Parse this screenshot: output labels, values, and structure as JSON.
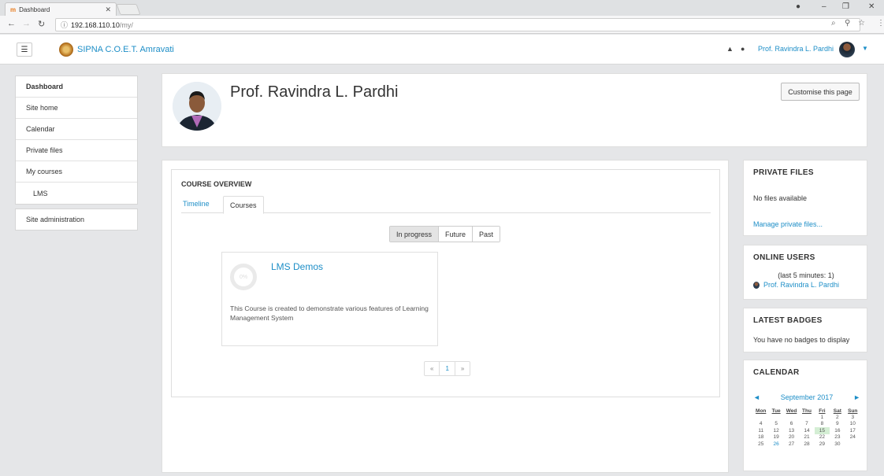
{
  "browser": {
    "tab_title": "Dashboard",
    "url_host": "192.168.110.10",
    "url_path": "/my/"
  },
  "header": {
    "site_name": "SIPNA C.O.E.T. Amravati",
    "user_name": "Prof. Ravindra L. Pardhi"
  },
  "nav": {
    "items": [
      {
        "label": "Dashboard"
      },
      {
        "label": "Site home"
      },
      {
        "label": "Calendar"
      },
      {
        "label": "Private files"
      },
      {
        "label": "My courses"
      },
      {
        "label": "LMS"
      }
    ],
    "admin": "Site administration"
  },
  "profile": {
    "name": "Prof. Ravindra L. Pardhi",
    "customise": "Customise this page"
  },
  "overview": {
    "title": "COURSE OVERVIEW",
    "tabs": [
      "Timeline",
      "Courses"
    ],
    "filters": [
      "In progress",
      "Future",
      "Past"
    ],
    "course": {
      "name": "LMS Demos",
      "progress": "0%",
      "description": "This Course is created to demonstrate various features of Learning Management System"
    },
    "pager": [
      "«",
      "1",
      "»"
    ]
  },
  "blocks": {
    "private_files": {
      "title": "PRIVATE FILES",
      "empty": "No files available",
      "manage": "Manage private files..."
    },
    "online_users": {
      "title": "ONLINE USERS",
      "summary": "(last 5 minutes: 1)",
      "user": "Prof. Ravindra L. Pardhi"
    },
    "badges": {
      "title": "LATEST BADGES",
      "empty": "You have no badges to display"
    },
    "calendar": {
      "title": "CALENDAR",
      "month": "September 2017",
      "prev": "◄",
      "next": "►",
      "days": [
        "Mon",
        "Tue",
        "Wed",
        "Thu",
        "Fri",
        "Sat",
        "Sun"
      ],
      "weeks": [
        [
          "",
          "",
          "",
          "",
          "1",
          "2",
          "3"
        ],
        [
          "4",
          "5",
          "6",
          "7",
          "8",
          "9",
          "10"
        ],
        [
          "11",
          "12",
          "13",
          "14",
          "15",
          "16",
          "17"
        ],
        [
          "18",
          "19",
          "20",
          "21",
          "22",
          "23",
          "24"
        ],
        [
          "25",
          "26",
          "27",
          "28",
          "29",
          "30",
          ""
        ]
      ]
    }
  },
  "colors": {
    "link": "#1d8ec7",
    "today_bg": "#d4eed4"
  }
}
